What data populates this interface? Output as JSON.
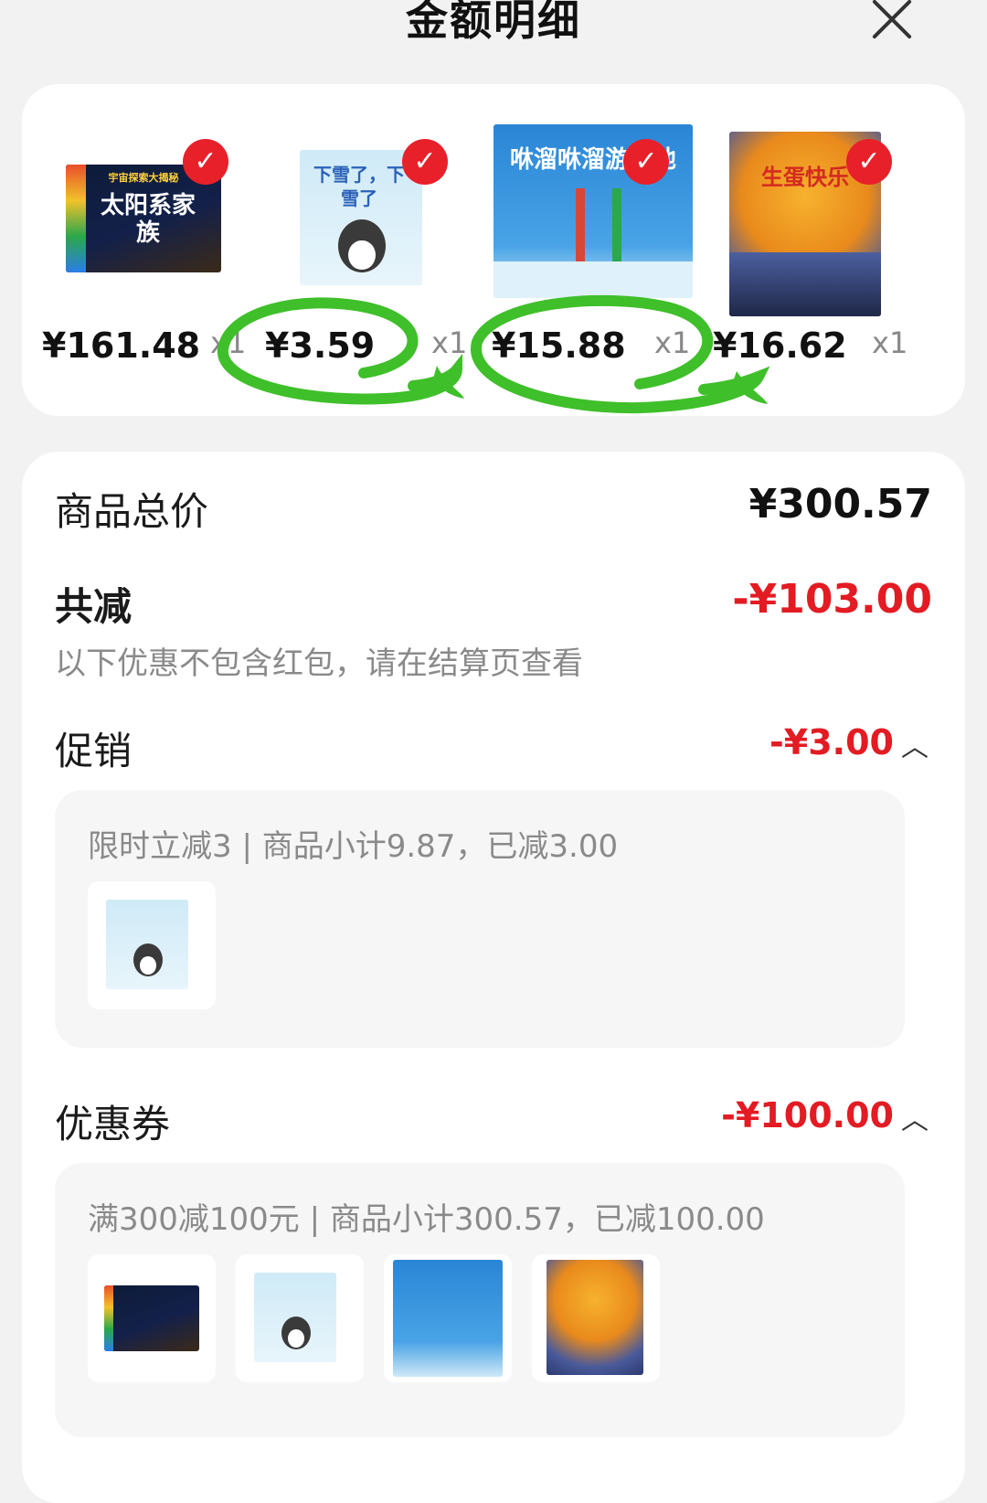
{
  "header": {
    "title": "金额明细"
  },
  "products": [
    {
      "price": "¥161.48",
      "qty": "x1",
      "cover_title": "太阳系家族",
      "cover_tag": "宇宙探索大揭秘",
      "checked": true
    },
    {
      "price": "¥3.59",
      "qty": "x1",
      "cover_title": "下雪了，下雪了",
      "checked": true
    },
    {
      "price": "¥15.88",
      "qty": "x1",
      "cover_title": "咻溜咻溜游泳池",
      "checked": true
    },
    {
      "price": "¥16.62",
      "qty": "x1",
      "cover_title": "生蛋快乐",
      "checked": true
    }
  ],
  "summary": {
    "total_label": "商品总价",
    "total_value": "¥300.57",
    "reduce_label": "共减",
    "reduce_value": "-¥103.00",
    "note": "以下优惠不包含红包，请在结算页查看"
  },
  "promotion": {
    "label": "促销",
    "value": "-¥3.00",
    "description": "限时立减3 | 商品小计9.87，已减3.00"
  },
  "coupon": {
    "label": "优惠券",
    "value": "-¥100.00",
    "description": "满300减100元 | 商品小计300.57，已减100.00"
  },
  "icons": {
    "check": "check-circle-icon",
    "close": "close-icon",
    "collapse": "chevron-up-icon"
  },
  "colors": {
    "accent_red": "#e31b23",
    "annotation_green": "#3fbf2a"
  }
}
